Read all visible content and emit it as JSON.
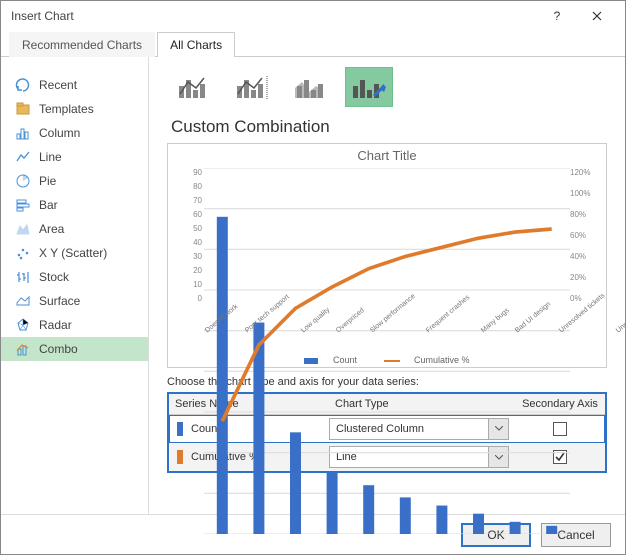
{
  "window": {
    "title": "Insert Chart"
  },
  "tabs": {
    "recommended": "Recommended Charts",
    "all": "All Charts"
  },
  "sidebar": {
    "items": [
      {
        "label": "Recent"
      },
      {
        "label": "Templates"
      },
      {
        "label": "Column"
      },
      {
        "label": "Line"
      },
      {
        "label": "Pie"
      },
      {
        "label": "Bar"
      },
      {
        "label": "Area"
      },
      {
        "label": "X Y (Scatter)"
      },
      {
        "label": "Stock"
      },
      {
        "label": "Surface"
      },
      {
        "label": "Radar"
      },
      {
        "label": "Combo"
      }
    ]
  },
  "subtype_label": "Custom Combination",
  "preview": {
    "title": "Chart Title"
  },
  "chart_data": {
    "type": "combo",
    "categories": [
      "Doesn't work",
      "Poor tech support",
      "Low quality",
      "Overpriced",
      "Slow performance",
      "Frequent crashes",
      "Many bugs",
      "Bad UI design",
      "Unresolved tickets",
      "Unresponsiveness"
    ],
    "series": [
      {
        "name": "Count",
        "type": "bar",
        "axis": "primary",
        "color": "#3a6fc7",
        "values": [
          78,
          52,
          25,
          15,
          12,
          9,
          7,
          5,
          3,
          2
        ]
      },
      {
        "name": "Cumulative %",
        "type": "line",
        "axis": "secondary",
        "color": "#e07b2c",
        "values": [
          37,
          62,
          74,
          81,
          87,
          91,
          94,
          97,
          99,
          100
        ]
      }
    ],
    "ylim_primary": [
      0,
      90
    ],
    "yticks_primary": [
      0,
      10,
      20,
      30,
      40,
      50,
      60,
      70,
      80,
      90
    ],
    "ylim_secondary": [
      0,
      120
    ],
    "yticks_secondary": [
      "0%",
      "20%",
      "40%",
      "60%",
      "80%",
      "100%",
      "120%"
    ],
    "legend": [
      "Count",
      "Cumulative %"
    ]
  },
  "series_section": {
    "caption": "Choose the chart type and axis for your data series:",
    "headers": {
      "name": "Series Name",
      "type": "Chart Type",
      "axis": "Secondary Axis"
    },
    "rows": [
      {
        "color": "#3a6fc7",
        "name": "Count",
        "type": "Clustered Column",
        "secondary": false
      },
      {
        "color": "#e07b2c",
        "name": "Cumulative %",
        "type": "Line",
        "secondary": true
      }
    ]
  },
  "buttons": {
    "ok": "OK",
    "cancel": "Cancel"
  }
}
